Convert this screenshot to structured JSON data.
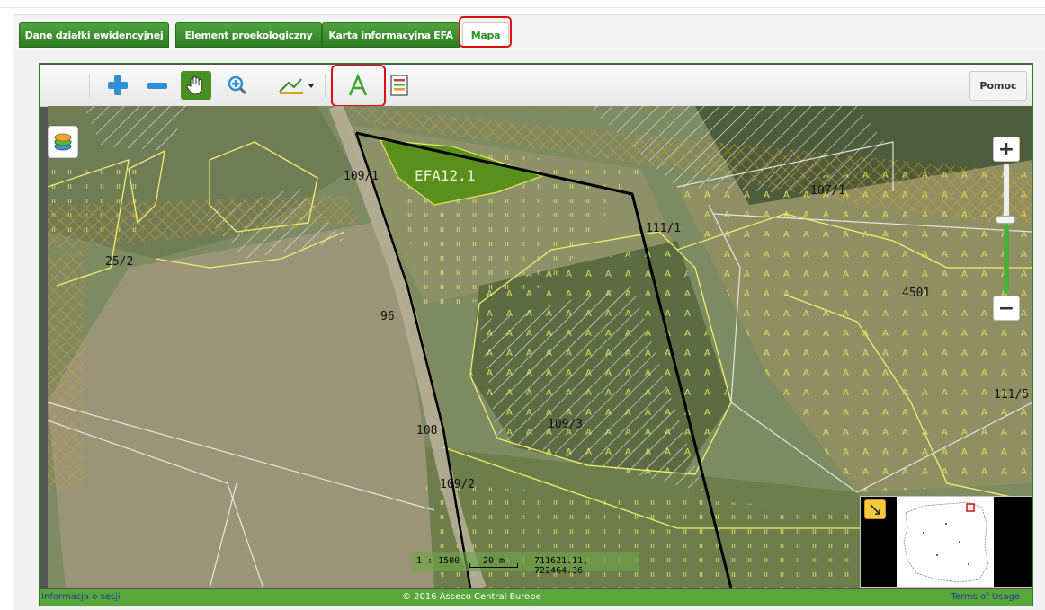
{
  "tabs": [
    {
      "label": "Dane działki ewidencyjnej"
    },
    {
      "label": "Element proekologiczny"
    },
    {
      "label": "Karta informacyjna EFA"
    },
    {
      "label": "Mapa",
      "active": true
    }
  ],
  "toolbar": {
    "tools": [
      "zoom-in-icon",
      "zoom-out-icon",
      "pan-hand-icon",
      "zoom-box-icon",
      "measure-icon",
      "draw-polygon-icon",
      "legend-icon"
    ],
    "help_label": "Pomoc"
  },
  "map": {
    "parcels": [
      "109/1",
      "107/1",
      "111/1",
      "25/2",
      "4501",
      "96",
      "111/5",
      "109/3",
      "108",
      "109/2"
    ],
    "efa_label": "EFA12.1",
    "scale": "1 : 1500",
    "scale_bar": "20 m",
    "coordinates": "711621.11, 722464.36"
  },
  "footer": {
    "session_info": "Informacja o sesji",
    "copyright": "© 2016 Asseco Central Europe",
    "terms": "Terms of Usage"
  },
  "colors": {
    "accent_green": "#4a9f35",
    "highlight_red": "#e01010",
    "parcel_line": "#f0f07a",
    "efa_fill": "#5a8f1e"
  }
}
